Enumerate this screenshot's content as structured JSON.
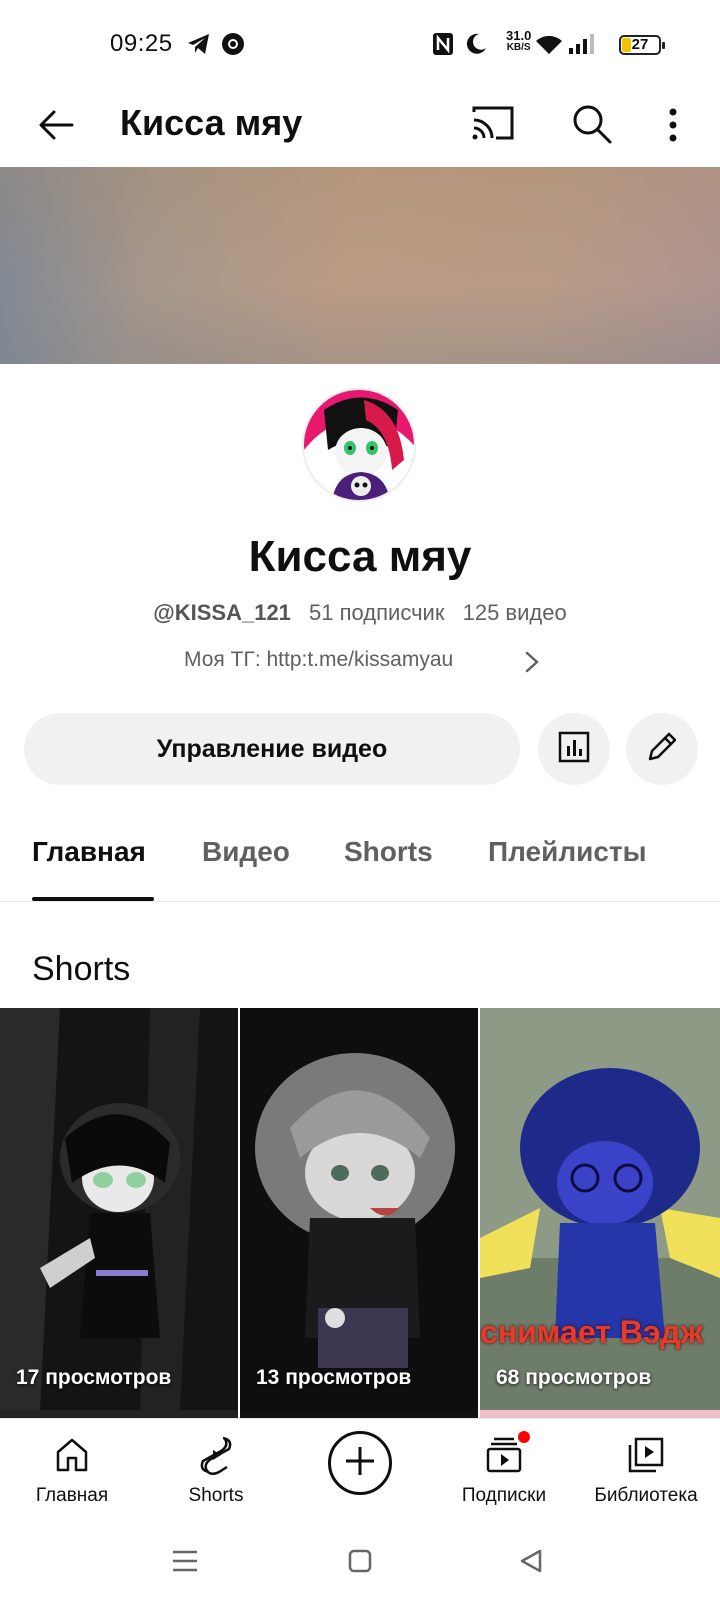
{
  "status_bar": {
    "time": "09:25",
    "speed_value": "31.0",
    "speed_unit": "KB/S",
    "battery": "27"
  },
  "app_bar": {
    "title": "Кисса мяу",
    "icons": [
      "back-arrow-icon",
      "cast-icon",
      "search-icon",
      "more-vert-icon"
    ]
  },
  "channel": {
    "name": "Кисса мяу",
    "handle": "@KISSA_121",
    "subscribers": "51 подписчик",
    "videos": "125 видео",
    "link": "Моя ТГ: http:t.me/kissamyau"
  },
  "actions": {
    "manage_label": "Управление видео",
    "icons": [
      "analytics-icon",
      "edit-pencil-icon"
    ]
  },
  "tabs": [
    {
      "label": "Главная",
      "active": true
    },
    {
      "label": "Видео",
      "active": false
    },
    {
      "label": "Shorts",
      "active": false
    },
    {
      "label": "Плейлисты",
      "active": false
    }
  ],
  "section": {
    "title": "Shorts"
  },
  "shorts": [
    {
      "views": "17 просмотров"
    },
    {
      "views": "13 просмотров"
    },
    {
      "views": "68 просмотров",
      "overlay_text": "снимает Вэдж"
    }
  ],
  "bottom_nav": [
    {
      "label": "Главная",
      "icon": "home-icon"
    },
    {
      "label": "Shorts",
      "icon": "shorts-icon"
    },
    {
      "label": "",
      "icon": "create-plus-icon"
    },
    {
      "label": "Подписки",
      "icon": "subscriptions-icon",
      "badge_color": "#ff0000"
    },
    {
      "label": "Библиотека",
      "icon": "library-icon"
    }
  ],
  "system_nav": [
    "menu-icon",
    "home-square-icon",
    "back-triangle-icon"
  ]
}
